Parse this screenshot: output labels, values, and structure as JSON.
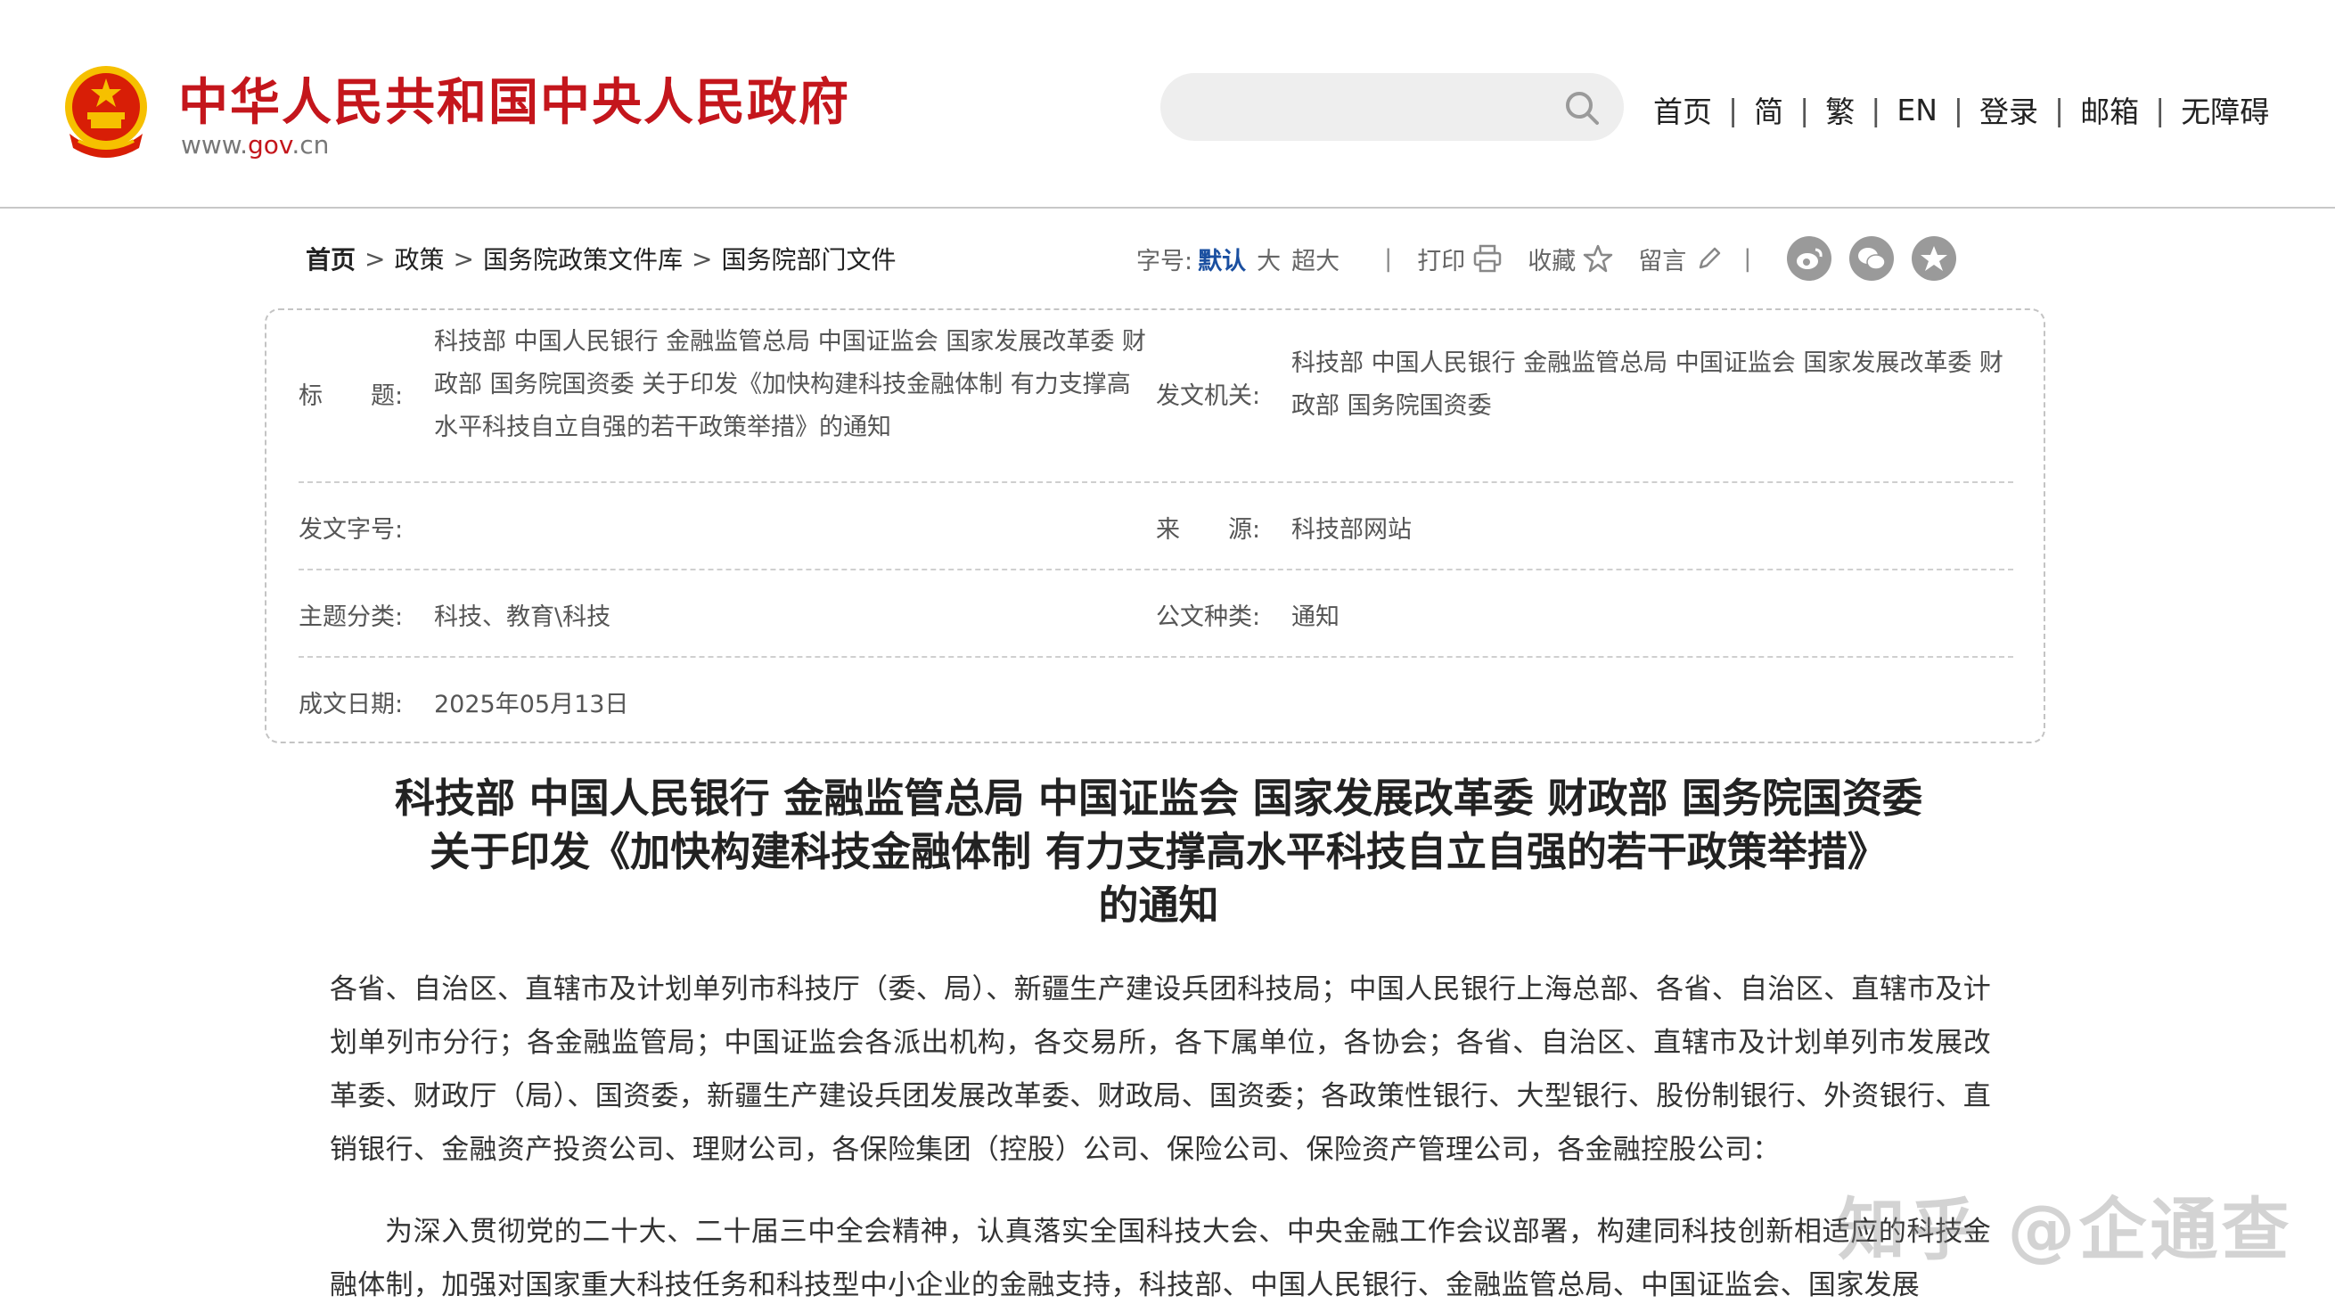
{
  "header": {
    "site_title": "中华人民共和国中央人民政府",
    "domain_prefix": "www.",
    "domain_gov": "gov",
    "domain_suffix": ".cn",
    "search_placeholder": "",
    "nav": [
      "首页",
      "简",
      "繁",
      "EN",
      "登录",
      "邮箱",
      "无障碍"
    ],
    "nav_sep": "|"
  },
  "breadcrumb": {
    "items": [
      "首页",
      "政策",
      "国务院政策文件库",
      "国务院部门文件"
    ],
    "arrow": ">"
  },
  "tools": {
    "font_label": "字号:",
    "font_default": "默认",
    "font_large": "大",
    "font_xlarge": "超大",
    "sep": "|",
    "print": "打印",
    "favorite": "收藏",
    "comment": "留言",
    "share_icons": [
      "weibo-icon",
      "wechat-icon",
      "qzone-icon"
    ]
  },
  "info": {
    "title_label": "标　　题:",
    "title_value": "科技部 中国人民银行 金融监管总局 中国证监会 国家发展改革委 财政部 国务院国资委 关于印发《加快构建科技金融体制 有力支撑高水平科技自立自强的若干政策举措》的通知",
    "issuer_label": "发文机关:",
    "issuer_value": "科技部 中国人民银行 金融监管总局 中国证监会 国家发展改革委 财政部 国务院国资委",
    "docno_label": "发文字号:",
    "docno_value": "",
    "source_label": "来　　源:",
    "source_value": "科技部网站",
    "topic_label": "主题分类:",
    "topic_value": "科技、教育\\科技",
    "type_label": "公文种类:",
    "type_value": "通知",
    "date_label": "成文日期:",
    "date_value": "2025年05月13日"
  },
  "article": {
    "title_line1": "科技部 中国人民银行 金融监管总局 中国证监会 国家发展改革委 财政部 国务院国资委",
    "title_line2": "关于印发《加快构建科技金融体制 有力支撑高水平科技自立自强的若干政策举措》",
    "title_line3": "的通知",
    "para1": "各省、自治区、直辖市及计划单列市科技厅（委、局）、新疆生产建设兵团科技局；中国人民银行上海总部、各省、自治区、直辖市及计划单列市分行；各金融监管局；中国证监会各派出机构，各交易所，各下属单位，各协会；各省、自治区、直辖市及计划单列市发展改革委、财政厅（局）、国资委，新疆生产建设兵团发展改革委、财政局、国资委；各政策性银行、大型银行、股份制银行、外资银行、直销银行、金融资产投资公司、理财公司，各保险集团（控股）公司、保险公司、保险资产管理公司，各金融控股公司：",
    "para2": "为深入贯彻党的二十大、二十届三中全会精神，认真落实全国科技大会、中央金融工作会议部署，构建同科技创新相适应的科技金融体制，加强对国家重大科技任务和科技型中小企业的金融支持，科技部、中国人民银行、金融监管总局、中国证监会、国家发展"
  },
  "watermark": "知乎 @企通查",
  "colors": {
    "brand_red": "#c4161c",
    "link_blue": "#1a4fa0",
    "emblem_gold": "#f6c000"
  }
}
